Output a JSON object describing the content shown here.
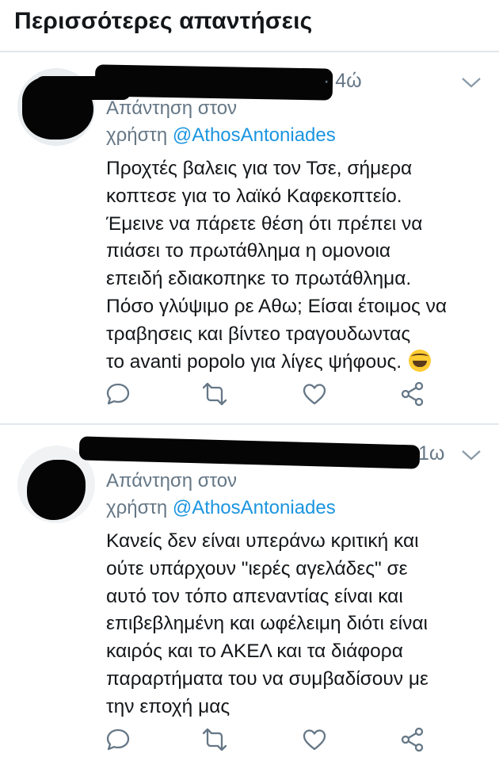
{
  "header": {
    "title": "Περισσότερες απαντήσεις"
  },
  "tweets": [
    {
      "time": "· 4ώ",
      "reply_label": "Απάντηση στον",
      "reply_prefix": "χρήστη",
      "reply_handle": "@AthosAntoniades",
      "text": "Προχτές βαλεις για τον Τσε, σήμερα\nκοπτεσε για το λαϊκό Καφεκοπτείο.\nΈμεινε να πάρετε θέση ότι πρέπει να\nπιάσει το πρωτάθλημα η ομονοια\nεπειδή εδιακοπηκε το πρωτάθλημα.\nΠόσο γλύψιμο ρε Αθω; Είσαι έτοιμος να\nτραβησεις και βίντεο τραγουδωντας\nτο avanti popolo για λίγες ψήφους.",
      "emoji": "grinning-squinting-face-emoji"
    },
    {
      "time": "1ω",
      "reply_label": "Απάντηση στον",
      "reply_prefix": "χρήστη",
      "reply_handle": "@AthosAntoniades",
      "text": "Κανείς δεν είναι υπεράνω κριτική και\nούτε υπάρχουν \"ιερές αγελάδες\" σε\nαυτό τον τόπο απεναντίας είναι και\nεπιβεβλημένη και ωφέλειμη διότι είναι\nκαιρός και το ΑΚΕΛ και τα διάφορα\nπαραρτήματα του να συμβαδίσουν με\nτην εποχή μας"
    }
  ],
  "actions": [
    "reply-icon",
    "retweet-icon",
    "like-icon",
    "share-icon"
  ],
  "colors": {
    "link": "#1b95e0",
    "muted": "#657786",
    "text": "#14171a",
    "divider": "#e1e8ed"
  }
}
